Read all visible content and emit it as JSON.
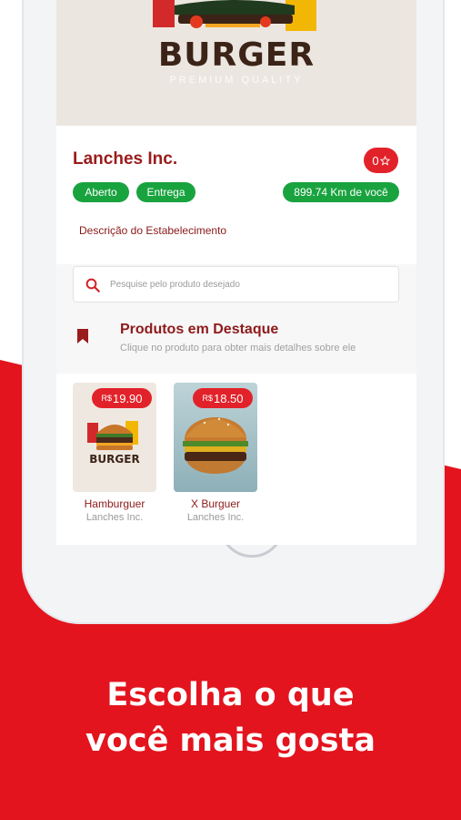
{
  "banner": {
    "brand": "BURGER",
    "tagline": "PREMIUM QUALITY"
  },
  "store": {
    "name": "Lanches Inc.",
    "rating": "0",
    "tags": {
      "open": "Aberto",
      "delivery": "Entrega",
      "distance": "899.74 Km de você"
    },
    "description_link": "Descrição do Estabelecimento"
  },
  "search": {
    "placeholder": "Pesquise pelo produto desejado"
  },
  "featured": {
    "title": "Produtos em Destaque",
    "subtitle": "Clique no produto para obter mais detalhes sobre ele"
  },
  "products": [
    {
      "currency": "R$",
      "price": "19.90",
      "name": "Hamburguer",
      "store": "Lanches Inc.",
      "image_text": "BURGER"
    },
    {
      "currency": "R$",
      "price": "18.50",
      "name": "X Burguer",
      "store": "Lanches Inc."
    }
  ],
  "promo": {
    "line1": "Escolha o que",
    "line2": "você mais gosta"
  },
  "colors": {
    "accent": "#e2222a",
    "brand_dark": "#8e1a1a",
    "success": "#19a33f"
  }
}
